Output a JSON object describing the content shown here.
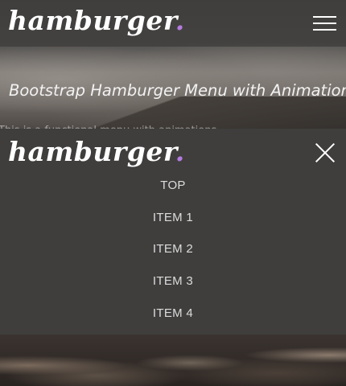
{
  "brand": {
    "name": "hamburger",
    "dot": ".",
    "dot_color": "#b57be0"
  },
  "hero": {
    "title": "Bootstrap Hamburger Menu with Animations",
    "subtitle": "This is a functional menu with animations"
  },
  "menu": {
    "close_icon": "close-icon",
    "open_icon": "hamburger-icon",
    "items": [
      "TOP",
      "ITEM 1",
      "ITEM 2",
      "ITEM 3",
      "ITEM 4"
    ]
  },
  "colors": {
    "overlay": "#3f3e3d",
    "text": "#ffffff",
    "item_text": "#dcdcdc"
  }
}
